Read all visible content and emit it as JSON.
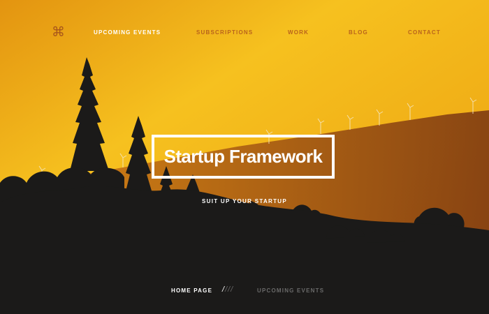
{
  "header": {
    "logo_icon": "command-icon",
    "logo_glyph": "⌘",
    "nav": [
      {
        "label": "UPCOMING EVENTS",
        "active": true
      },
      {
        "label": "SUBSCRIPTIONS",
        "active": false
      },
      {
        "label": "WORK",
        "active": false
      },
      {
        "label": "BLOG",
        "active": false
      },
      {
        "label": "CONTACT",
        "active": false
      }
    ]
  },
  "hero": {
    "title": "Startup Framework",
    "subtitle": "SUIT UP YOUR STARTUP"
  },
  "footer_nav": {
    "home": "HOME PAGE",
    "separator_active": "/",
    "separator_rest": "///",
    "upcoming": "UPCOMING EVENTS"
  },
  "colors": {
    "sky_top": "#e89a0e",
    "sky_mid": "#f7c31e",
    "hill": "#9b4a10",
    "silhouette": "#1b1a19",
    "nav_inactive": "#b9631c",
    "text_light": "#ffffff"
  }
}
